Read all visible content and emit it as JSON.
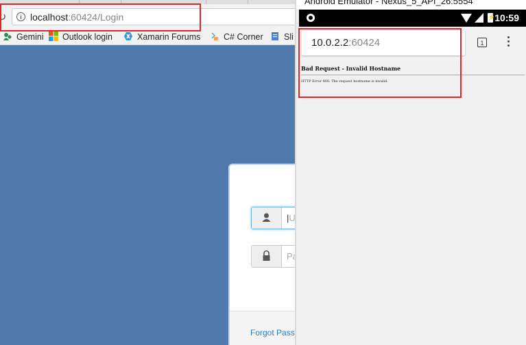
{
  "desktop_browser": {
    "address": {
      "host": "localhost",
      "port_path": ":60424/Login"
    },
    "bookmarks": [
      {
        "label": "Gemini",
        "icon": "gemini-icon"
      },
      {
        "label": "Outlook login",
        "icon": "microsoft-icon"
      },
      {
        "label": "Xamarin Forums",
        "icon": "xamarin-icon"
      },
      {
        "label": "C# Corner",
        "icon": "csharp-corner-icon"
      },
      {
        "label": "Sli",
        "icon": "document-icon"
      }
    ],
    "login": {
      "username_placeholder": "U",
      "password_placeholder": "Pa",
      "forgot_link": "Forgot Passw"
    },
    "colors": {
      "background": "#4f7aab",
      "link": "#337ab7"
    }
  },
  "emulator": {
    "window_title": "Android Emulator - Nexus_5_API_26:5554",
    "status_time": "10:59",
    "address": {
      "host": "10.0.2.2",
      "port": ":60424"
    },
    "tab_count": "1",
    "error_title": "Bad Request - Invalid Hostname",
    "error_text": "HTTP Error 400. The request hostname is invalid."
  },
  "highlight_color": "#e0242c"
}
